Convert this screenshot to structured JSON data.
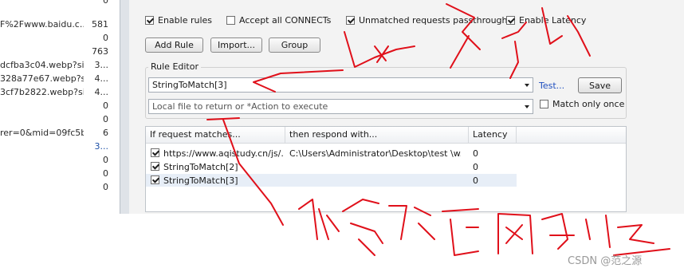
{
  "sessions": [
    {
      "url": "",
      "size": "0",
      "dim": false
    },
    {
      "url": "F%2Fwww.baidu.c...",
      "size": "581",
      "dim": false
    },
    {
      "url": "",
      "size": "0",
      "dim": false
    },
    {
      "url": "",
      "size": "763",
      "dim": false
    },
    {
      "url": "dcfba3c04.webp?siz...",
      "size": "3...",
      "dim": false
    },
    {
      "url": "328a77e67.webp?si...",
      "size": "4...",
      "dim": false
    },
    {
      "url": "3cf7b2822.webp?si...",
      "size": "4...",
      "dim": false
    },
    {
      "url": "",
      "size": "0",
      "dim": false
    },
    {
      "url": "",
      "size": "0",
      "dim": false
    },
    {
      "url": "rer=0&mid=09fc5b...",
      "size": "6",
      "dim": false
    },
    {
      "url": "",
      "size": "3...",
      "dim": false,
      "blue": true
    },
    {
      "url": "",
      "size": "0",
      "dim": false
    },
    {
      "url": "",
      "size": "0",
      "dim": false
    },
    {
      "url": "",
      "size": "0",
      "dim": false
    }
  ],
  "options": {
    "enable_rules": "Enable rules",
    "accept_connects": "Accept all CONNECTs",
    "unmatched_passthrough": "Unmatched requests passthrough",
    "enable_latency": "Enable Latency"
  },
  "buttons": {
    "add_rule": "Add Rule",
    "import": "Import...",
    "group": "Group",
    "save": "Save"
  },
  "rule_editor": {
    "legend": "Rule Editor",
    "match_value": "StringToMatch[3]",
    "action_placeholder": "Local file to return or *Action to execute",
    "test_link": "Test...",
    "match_only_once": "Match only once"
  },
  "rules_table": {
    "columns": [
      "If request matches...",
      "then respond with...",
      "Latency"
    ],
    "rows": [
      {
        "match": "https://www.aqistudy.cn/js/...",
        "respond": "C:\\Users\\Administrator\\Desktop\\test \\w...",
        "latency": "0",
        "checked": true
      },
      {
        "match": "StringToMatch[2]",
        "respond": "",
        "latency": "0",
        "checked": true
      },
      {
        "match": "StringToMatch[3]",
        "respond": "",
        "latency": "0",
        "checked": true,
        "selected": true
      }
    ]
  },
  "watermark": "CSDN @范之源",
  "colors": {
    "annotation_red": "#e0101a",
    "link_blue": "#1f4fbf",
    "panel_bg": "#f3f3f3"
  }
}
